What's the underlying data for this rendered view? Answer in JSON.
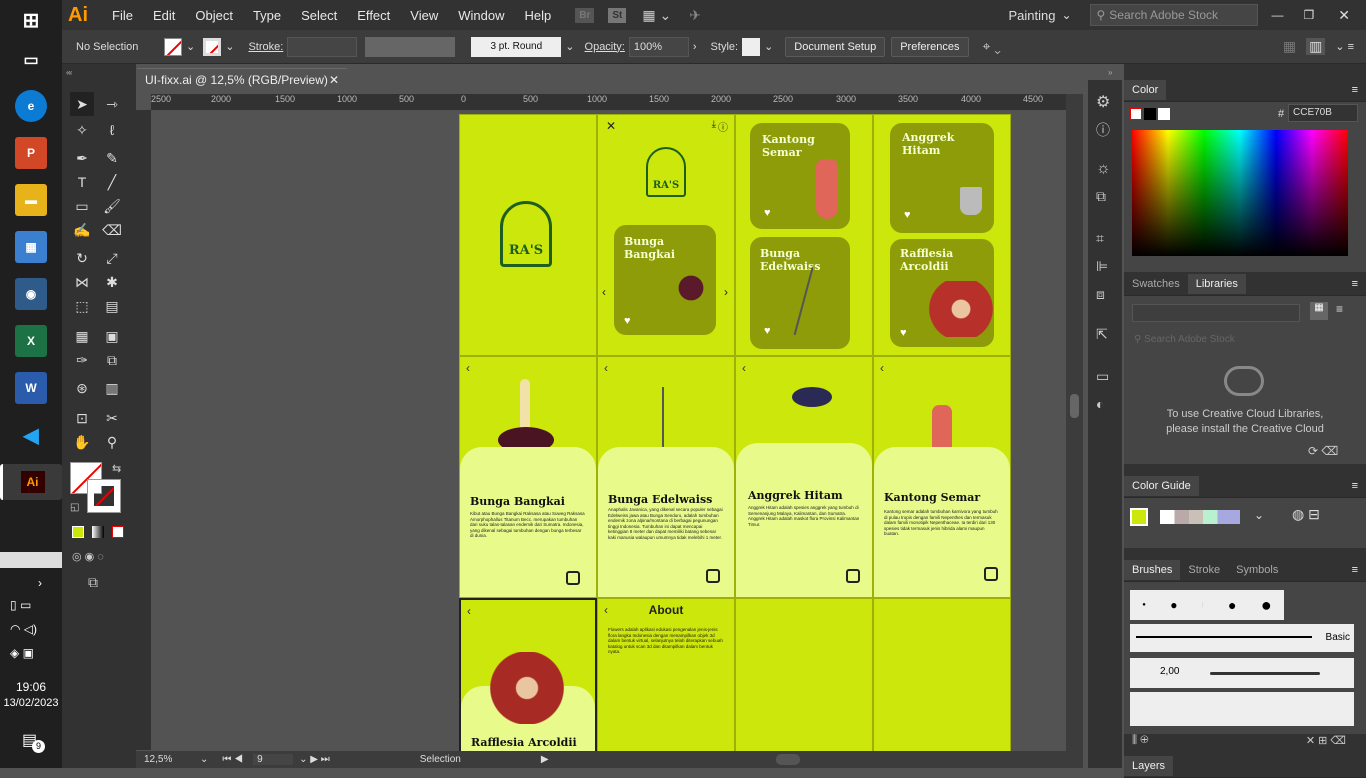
{
  "taskbar": {
    "clock_time": "19:06",
    "clock_date": "13/02/2023",
    "notif_count": "9",
    "apps": [
      "windows-start",
      "task-view",
      "edge",
      "powerpoint",
      "file-explorer",
      "control-panel",
      "camera",
      "excel",
      "word",
      "vscode",
      "illustrator"
    ]
  },
  "menubar": {
    "logo": "Ai",
    "items": [
      "File",
      "Edit",
      "Object",
      "Type",
      "Select",
      "Effect",
      "View",
      "Window",
      "Help"
    ],
    "br": "Br",
    "st": "St",
    "workspace": "Painting",
    "search_placeholder": "Search Adobe Stock"
  },
  "control": {
    "selection": "No Selection",
    "stroke_label": "Stroke:",
    "brush": "3 pt. Round",
    "opacity_label": "Opacity:",
    "opacity": "100%",
    "style_label": "Style:",
    "doc_setup": "Document Setup",
    "preferences": "Preferences"
  },
  "document": {
    "tab_title": "UI-fixx.ai @ 12,5% (RGB/Preview)",
    "zoom": "12,5%",
    "artboard": "9",
    "mode": "Selection"
  },
  "ruler": {
    "top": [
      "2500",
      "2000",
      "1500",
      "1000",
      "500",
      "0",
      "500",
      "1000",
      "1500",
      "2000",
      "2500",
      "3000",
      "3500",
      "4000",
      "4500"
    ],
    "left": [
      "5",
      "0",
      "1",
      "0",
      "1",
      "5",
      "2",
      "0",
      "2",
      "5",
      "3",
      "0",
      "3",
      "5",
      "4",
      "0",
      "4",
      "5"
    ]
  },
  "app": {
    "logo_text": "RA'S",
    "cards": {
      "kantong": "Kantong Semar",
      "anggrek": "Anggrek Hitam",
      "bangkai": "Bunga Bangkai",
      "edelwaiss": "Bunga Edelwaiss",
      "rafflesia": "Rafflesia Arcoldii"
    },
    "details": [
      {
        "name": "Bunga Bangkai",
        "desc": "Kibut atau Bunga Bangkai Raksasa atau Suweg Raksasa Amorphophallus Titanum Becc. merupakan tumbuhan dari suku talas-talasan endemik dari Sumatra. Indonesia, yang dikenal sebagai tumbuhan dengan bunga terbesar di dunia."
      },
      {
        "name": "Bunga Edelwaiss",
        "desc": "Anaphalis Javanica, yang dikenal secara populer sebagai Edelweiss jawa atau Bunga Senduro, adalah tumbuhan endemik zona alpina/montana di berbagai pegunungan tinggi Indonesia. Tumbuhan ini dapat mencapai ketinggian 8 meter dan dapat memiliki batang sebesar kaki manusia walaupun umumnya tidak melebihi 1 meter."
      },
      {
        "name": "Anggrek Hitam",
        "desc": "Anggrek Hitam adalah spesies anggrek yang tumbuh di Semenanjung Malaya, Kalimantan, dan Sumatra. Anggrek Hitam adalah maskot flora Provinsi Kalimantan Timur."
      },
      {
        "name": "Kantong Semar",
        "desc": "Kantong semar adalah tumbuhan karnivora yang tumbuh di pulau tropis dengan famili Nepenthes dan termasuk dalam famili monotipik Nepenthaceae. Ia terdiri dari 130 spesies tidak termasuk jenis hibrida alami maupun buatan."
      }
    ],
    "last_name": "Rafflesia Arcoldii",
    "about_title": "About",
    "about_text": "Flowers adalah aplikasi edukasi pengenalan jenis-jenis flora langka Indonesia dengan menampilkan objek 3d dalam bentuk virtual, selanjutnya telah diterapkan sebuah katalog untuk scan 3d dan ditampilkan dalam bentuk nyata."
  },
  "panels": {
    "color_title": "Color",
    "hex": "CCE70B",
    "swatches_tab": "Swatches",
    "libraries_tab": "Libraries",
    "lib_search": "Search Adobe Stock",
    "lib_msg1": "To use Creative Cloud Libraries,",
    "lib_msg2": "please install the Creative Cloud",
    "guide_title": "Color Guide",
    "brushes_tab": "Brushes",
    "stroke_tab": "Stroke",
    "symbols_tab": "Symbols",
    "basic_label": "Basic",
    "size_label": "2,00",
    "layers_title": "Layers"
  }
}
